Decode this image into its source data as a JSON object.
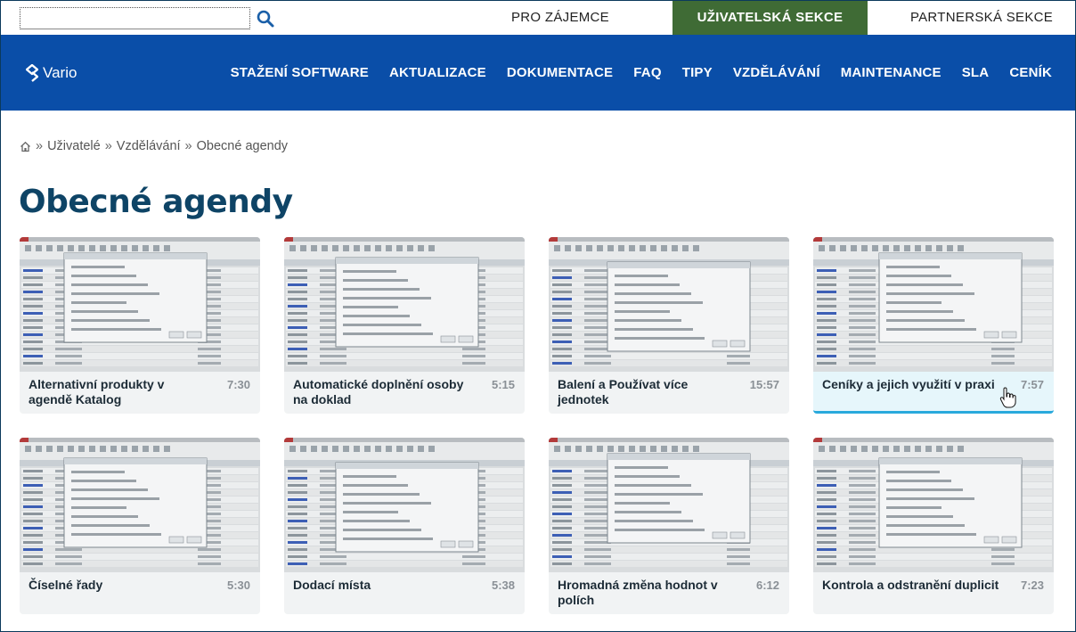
{
  "search": {
    "placeholder": "",
    "value": ""
  },
  "topnav": [
    {
      "label": "PRO ZÁJEMCE",
      "active": false
    },
    {
      "label": "UŽIVATELSKÁ SEKCE",
      "active": true
    },
    {
      "label": "PARTNERSKÁ SEKCE",
      "active": false
    }
  ],
  "brand": {
    "name": "Vario",
    "accent": "#0a4ea8",
    "active_tab_color": "#3f6b35"
  },
  "mainnav": [
    "STAŽENÍ SOFTWARE",
    "AKTUALIZACE",
    "DOKUMENTACE",
    "FAQ",
    "TIPY",
    "VZDĚLÁVÁNÍ",
    "MAINTENANCE",
    "SLA",
    "CENÍK"
  ],
  "breadcrumb": {
    "home_icon": "home-icon",
    "items": [
      "Uživatelé",
      "Vzdělávání",
      "Obecné agendy"
    ]
  },
  "page_title": "Obecné agendy",
  "cards": [
    {
      "title": "Alternativní produkty v agendě Katalog",
      "duration": "7:30"
    },
    {
      "title": "Automatické doplnění osoby na doklad",
      "duration": "5:15"
    },
    {
      "title": "Balení a Používat více jednotek",
      "duration": "15:57"
    },
    {
      "title": "Ceníky a jejich využití v praxi",
      "duration": "7:57",
      "hovered": true
    },
    {
      "title": "Číselné řady",
      "duration": "5:30"
    },
    {
      "title": "Dodací místa",
      "duration": "5:38"
    },
    {
      "title": "Hromadná změna hodnot v polích",
      "duration": "6:12"
    },
    {
      "title": "Kontrola a odstranění duplicit",
      "duration": "7:23"
    }
  ]
}
